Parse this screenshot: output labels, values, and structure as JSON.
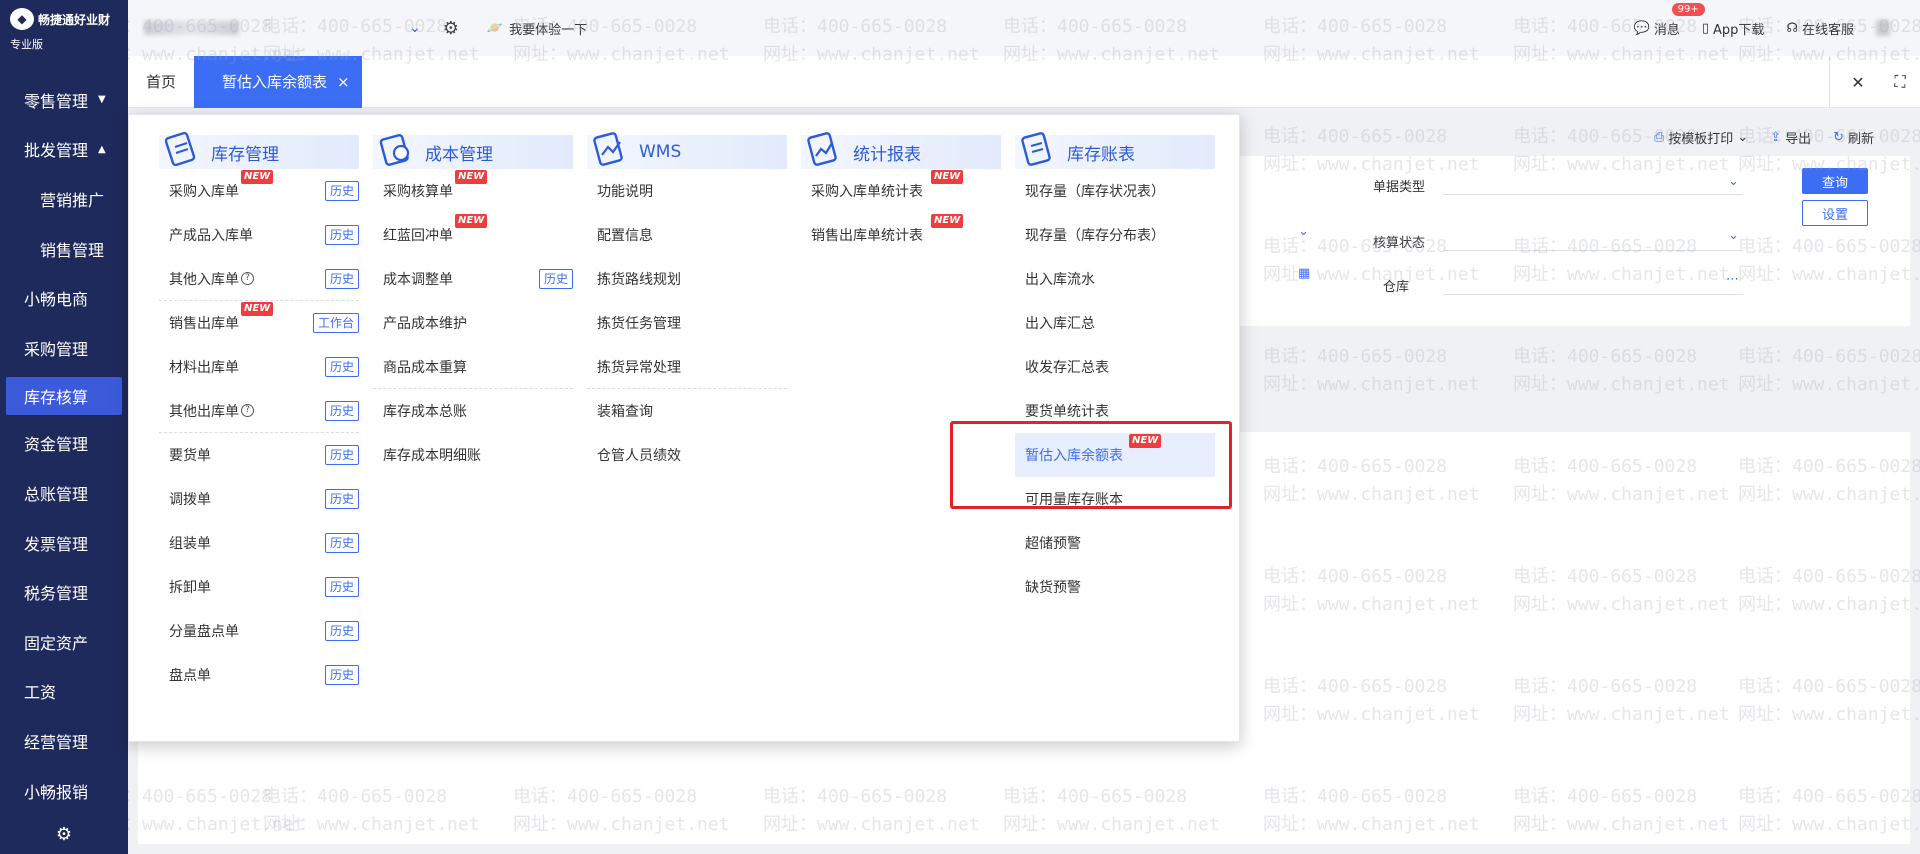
{
  "sidebar": {
    "brand": "畅捷通好业财",
    "edition": "专业版",
    "items": [
      {
        "label": "零售管理",
        "caret": "▼"
      },
      {
        "label": "批发管理",
        "caret": "▲"
      },
      {
        "label": "营销推广"
      },
      {
        "label": "销售管理"
      },
      {
        "label": "小畅电商"
      },
      {
        "label": "采购管理"
      },
      {
        "label": "库存核算",
        "active": true
      },
      {
        "label": "资金管理"
      },
      {
        "label": "总账管理"
      },
      {
        "label": "发票管理"
      },
      {
        "label": "税务管理"
      },
      {
        "label": "固定资产"
      },
      {
        "label": "工资"
      },
      {
        "label": "经营管理"
      },
      {
        "label": "小畅报销"
      }
    ],
    "footer_icon": "gear-icon"
  },
  "topbar": {
    "try_label": "我要体验一下",
    "messages_label": "消息",
    "messages_badge": "99+",
    "app_download_label": "App下载",
    "online_service_label": "在线客服"
  },
  "tabs": {
    "home_label": "首页",
    "active_label": "暂估入库余额表",
    "close_glyph": "×"
  },
  "toolbar": {
    "print_label": "按模板打印",
    "export_label": "导出",
    "refresh_label": "刷新"
  },
  "filters": {
    "doc_type_label": "单据类型",
    "accounting_status_label": "核算状态",
    "warehouse_label": "仓库",
    "query_button": "查询",
    "settings_button": "设置"
  },
  "menu": {
    "history_label": "历史",
    "workbench_label": "工作台",
    "new_label": "NEW",
    "columns": [
      {
        "title": "库存管理",
        "items": [
          {
            "label": "采购入库单",
            "new": true,
            "hist": true
          },
          {
            "label": "产成品入库单",
            "hist": true
          },
          {
            "label": "其他入库单",
            "help": true,
            "hist": true
          },
          {
            "label": "销售出库单",
            "new": true,
            "workbench": true
          },
          {
            "label": "材料出库单",
            "hist": true
          },
          {
            "label": "其他出库单",
            "help": true,
            "hist": true
          },
          {
            "label": "要货单",
            "hist": true
          },
          {
            "label": "调拨单",
            "hist": true
          },
          {
            "label": "组装单",
            "hist": true
          },
          {
            "label": "拆卸单",
            "hist": true
          },
          {
            "label": "分量盘点单",
            "hist": true
          },
          {
            "label": "盘点单",
            "hist": true
          }
        ]
      },
      {
        "title": "成本管理",
        "items": [
          {
            "label": "采购核算单",
            "new": true
          },
          {
            "label": "红蓝回冲单",
            "new": true
          },
          {
            "label": "成本调整单",
            "hist": true
          },
          {
            "label": "产品成本维护"
          },
          {
            "label": "商品成本重算"
          },
          {
            "label": "库存成本总账"
          },
          {
            "label": "库存成本明细账"
          }
        ]
      },
      {
        "title": "WMS",
        "items": [
          {
            "label": "功能说明"
          },
          {
            "label": "配置信息"
          },
          {
            "label": "拣货路线规划"
          },
          {
            "label": "拣货任务管理"
          },
          {
            "label": "拣货异常处理"
          },
          {
            "label": "装箱查询"
          },
          {
            "label": "仓管人员绩效"
          }
        ]
      },
      {
        "title": "统计报表",
        "items": [
          {
            "label": "采购入库单统计表",
            "new": true
          },
          {
            "label": "销售出库单统计表",
            "new": true
          }
        ]
      },
      {
        "title": "库存账表",
        "items": [
          {
            "label": "现存量（库存状况表）"
          },
          {
            "label": "现存量（库存分布表）"
          },
          {
            "label": "出入库流水"
          },
          {
            "label": "出入库汇总"
          },
          {
            "label": "收发存汇总表"
          },
          {
            "label": "要货单统计表"
          },
          {
            "label": "暂估入库余额表",
            "new": true,
            "highlight": true
          },
          {
            "label": "可用量库存账本"
          },
          {
            "label": "超储预警"
          },
          {
            "label": "缺货预警"
          }
        ]
      }
    ]
  },
  "watermark": {
    "phone": "电话：400-665-0028",
    "site": "网址：www.chanjet.net"
  },
  "colors": {
    "sidebar_bg": "#1f2a5c",
    "accent": "#3b6ef5",
    "new_badge": "#f03c3c",
    "highlight_box": "#e02424"
  }
}
